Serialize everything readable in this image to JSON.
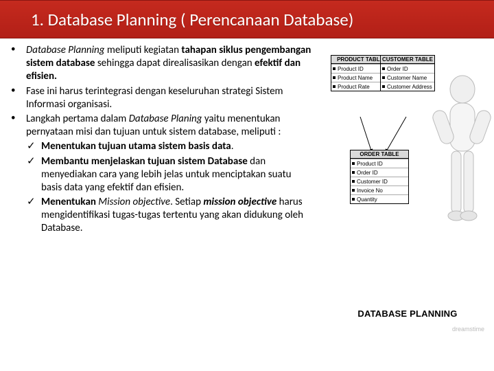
{
  "header": {
    "title": "1. Database Planning ( Perencanaan Database)"
  },
  "body": {
    "bullets": {
      "b1_a": "Database Planning",
      "b1_b": "  meliputi kegiatan ",
      "b1_c": "tahapan siklus pengembangan sistem database ",
      "b1_d": "sehingga dapat direalisasikan dengan ",
      "b1_e": "efektif  dan efisien.",
      "b2": "Fase ini harus terintegrasi dengan keseluruhan strategi Sistem Informasi organisasi.",
      "b3_a": "Langkah pertama dalam ",
      "b3_b": "Database Planing",
      "b3_c": " yaitu menentukan pernyataan misi dan tujuan untuk sistem database, meliputi :"
    },
    "checks": {
      "c1_a": "Menentukan  tujuan  utama sistem  basis  data",
      "c1_b": ".",
      "c2_a": "Membantu  menjelaskan tujuan sistem Database",
      "c2_b": " dan menyediakan cara yang lebih jelas untuk menciptakan  suatu  basis  data  yang  efektif  dan efisien.",
      "c3_a": "Menentukan ",
      "c3_b": "Mission  objective",
      "c3_c": ".  Setiap  ",
      "c3_d": "mission objective",
      "c3_e": "  harus  mengidentifikasi  tugas-tugas tertentu  yang akan didukung oleh Database."
    }
  },
  "figure": {
    "caption": "DATABASE PLANNING",
    "watermark": "dreamstime",
    "tables": {
      "product": {
        "head": "PRODUCT TABLE",
        "r1": "Product ID",
        "r2": "Product Name",
        "r3": "Product Rate"
      },
      "customer": {
        "head": "CUSTOMER TABLE",
        "r1": "Order ID",
        "r2": "Customer Name",
        "r3": "Customer Address"
      },
      "order": {
        "head": "ORDER TABLE",
        "r1": "Product ID",
        "r2": "Order ID",
        "r3": "Customer ID",
        "r4": "Invoice No",
        "r5": "Quantity"
      }
    }
  }
}
